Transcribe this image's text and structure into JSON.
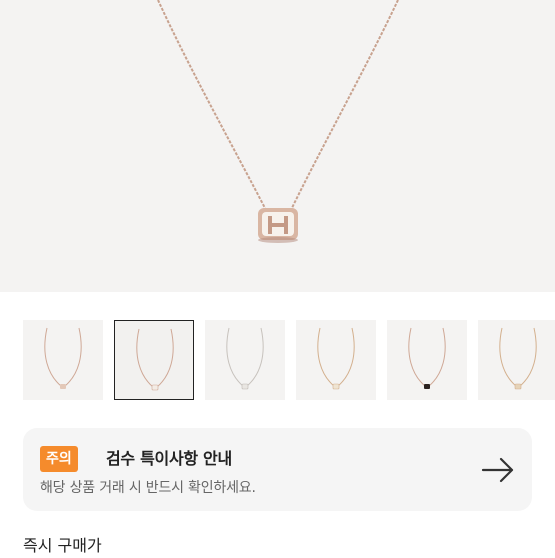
{
  "notice": {
    "badge": "주의",
    "title": "검수 특이사항 안내",
    "subtitle": "해당 상품 거래 시 반드시 확인하세요.",
    "arrow_icon": "arrow-right-icon"
  },
  "thumbnails": [
    {
      "selected": false,
      "pendant": "rose-charm"
    },
    {
      "selected": true,
      "pendant": "white-h-charm"
    },
    {
      "selected": false,
      "pendant": "silver-h-charm"
    },
    {
      "selected": false,
      "pendant": "gold-h-charm"
    },
    {
      "selected": false,
      "pendant": "black-h-charm"
    },
    {
      "selected": false,
      "pendant": "gold-h-charm"
    }
  ],
  "purchase": {
    "instant_buy_label": "즉시 구매가"
  },
  "colors": {
    "accent": "#f58b2c",
    "chain": "#c9a08f",
    "background": "#f4f3f2"
  }
}
